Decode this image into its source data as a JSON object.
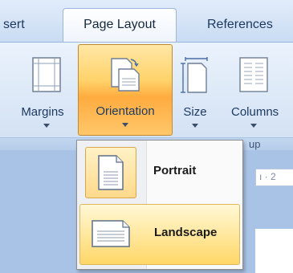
{
  "tabs": {
    "insert": "sert",
    "page_layout": "Page Layout",
    "references": "References"
  },
  "ribbon": {
    "margins": "Margins",
    "orientation": "Orientation",
    "size": "Size",
    "columns": "Columns",
    "group_label": "up"
  },
  "ruler_text": "ı · 2",
  "orientation_menu": {
    "items": [
      {
        "label": "Portrait",
        "icon": "portrait-page-icon"
      },
      {
        "label": "Landscape",
        "icon": "landscape-page-icon"
      }
    ],
    "highlighted": "Landscape"
  },
  "colors": {
    "highlight_orange": "#ffc24f",
    "ribbon_blue": "#dce8f7",
    "text_dark_blue": "#1e3a62"
  }
}
